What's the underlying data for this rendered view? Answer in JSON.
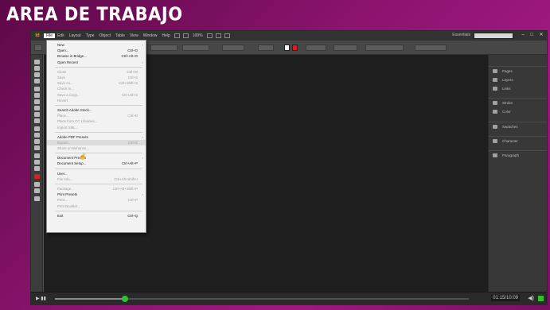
{
  "slide_title": "AREA DE TRABAJO",
  "menubar": {
    "logo": "Id",
    "items": [
      "File",
      "Edit",
      "Layout",
      "Type",
      "Object",
      "Table",
      "View",
      "Window",
      "Help"
    ],
    "zoom": "100%",
    "workspace": "Essentials"
  },
  "file_menu": {
    "items": [
      {
        "label": "New",
        "shortcut": "",
        "submenu": true,
        "disabled": false
      },
      {
        "label": "Open...",
        "shortcut": "Ctrl+O",
        "submenu": false,
        "disabled": false
      },
      {
        "label": "Browse in Bridge...",
        "shortcut": "Ctrl+Alt+O",
        "submenu": false,
        "disabled": false
      },
      {
        "label": "Open Recent",
        "shortcut": "",
        "submenu": true,
        "disabled": false
      },
      {
        "separator": true
      },
      {
        "label": "Close",
        "shortcut": "Ctrl+W",
        "submenu": false,
        "disabled": true
      },
      {
        "label": "Save",
        "shortcut": "Ctrl+S",
        "submenu": false,
        "disabled": true
      },
      {
        "label": "Save As...",
        "shortcut": "Ctrl+Shift+S",
        "submenu": false,
        "disabled": true
      },
      {
        "label": "Check In...",
        "shortcut": "",
        "submenu": false,
        "disabled": true
      },
      {
        "label": "Save a Copy...",
        "shortcut": "Ctrl+Alt+S",
        "submenu": false,
        "disabled": true
      },
      {
        "label": "Revert",
        "shortcut": "",
        "submenu": false,
        "disabled": true
      },
      {
        "separator": true
      },
      {
        "label": "Search Adobe Stock...",
        "shortcut": "",
        "submenu": false,
        "disabled": false
      },
      {
        "label": "Place...",
        "shortcut": "Ctrl+D",
        "submenu": false,
        "disabled": true
      },
      {
        "label": "Place from CC Libraries...",
        "shortcut": "",
        "submenu": false,
        "disabled": true
      },
      {
        "label": "Import XML...",
        "shortcut": "",
        "submenu": false,
        "disabled": true
      },
      {
        "separator": true
      },
      {
        "label": "Adobe PDF Presets",
        "shortcut": "",
        "submenu": true,
        "disabled": false
      },
      {
        "label": "Export...",
        "shortcut": "Ctrl+E",
        "submenu": false,
        "disabled": true,
        "hover": true
      },
      {
        "label": "Share on Behance...",
        "shortcut": "",
        "submenu": false,
        "disabled": true
      },
      {
        "separator": true
      },
      {
        "label": "Document Presets",
        "shortcut": "",
        "submenu": true,
        "disabled": false
      },
      {
        "label": "Document Setup...",
        "shortcut": "Ctrl+Alt+P",
        "submenu": false,
        "disabled": false
      },
      {
        "separator": true
      },
      {
        "label": "User...",
        "shortcut": "",
        "submenu": false,
        "disabled": false
      },
      {
        "label": "File Info...",
        "shortcut": "Ctrl+Alt+Shift+I",
        "submenu": false,
        "disabled": true
      },
      {
        "separator": true
      },
      {
        "label": "Package...",
        "shortcut": "Ctrl+Alt+Shift+P",
        "submenu": false,
        "disabled": true
      },
      {
        "label": "Print Presets",
        "shortcut": "",
        "submenu": true,
        "disabled": false
      },
      {
        "label": "Print...",
        "shortcut": "Ctrl+P",
        "submenu": false,
        "disabled": true
      },
      {
        "label": "Print Booklet...",
        "shortcut": "",
        "submenu": false,
        "disabled": true
      },
      {
        "separator": true
      },
      {
        "label": "Exit",
        "shortcut": "Ctrl+Q",
        "submenu": false,
        "disabled": false
      }
    ]
  },
  "panels": {
    "groups": [
      {
        "items": [
          {
            "label": "Pages",
            "icon": "pages-icon"
          },
          {
            "label": "Layers",
            "icon": "layers-icon"
          },
          {
            "label": "Links",
            "icon": "links-icon"
          }
        ]
      },
      {
        "items": [
          {
            "label": "Stroke",
            "icon": "stroke-icon"
          },
          {
            "label": "Color",
            "icon": "color-icon"
          }
        ]
      },
      {
        "items": [
          {
            "label": "Swatches",
            "icon": "swatches-icon"
          }
        ]
      },
      {
        "items": [
          {
            "label": "Character",
            "icon": "character-icon"
          }
        ]
      },
      {
        "items": [
          {
            "label": "Paragraph",
            "icon": "paragraph-icon"
          }
        ]
      }
    ]
  },
  "player": {
    "time": "01:15/10:09",
    "progress": 0.17,
    "accent": "#2fbf2f"
  },
  "colors": {
    "background": "#8c1470",
    "menu_hover": "#dcdcdc",
    "fill_swatch": "#e11c1c"
  }
}
